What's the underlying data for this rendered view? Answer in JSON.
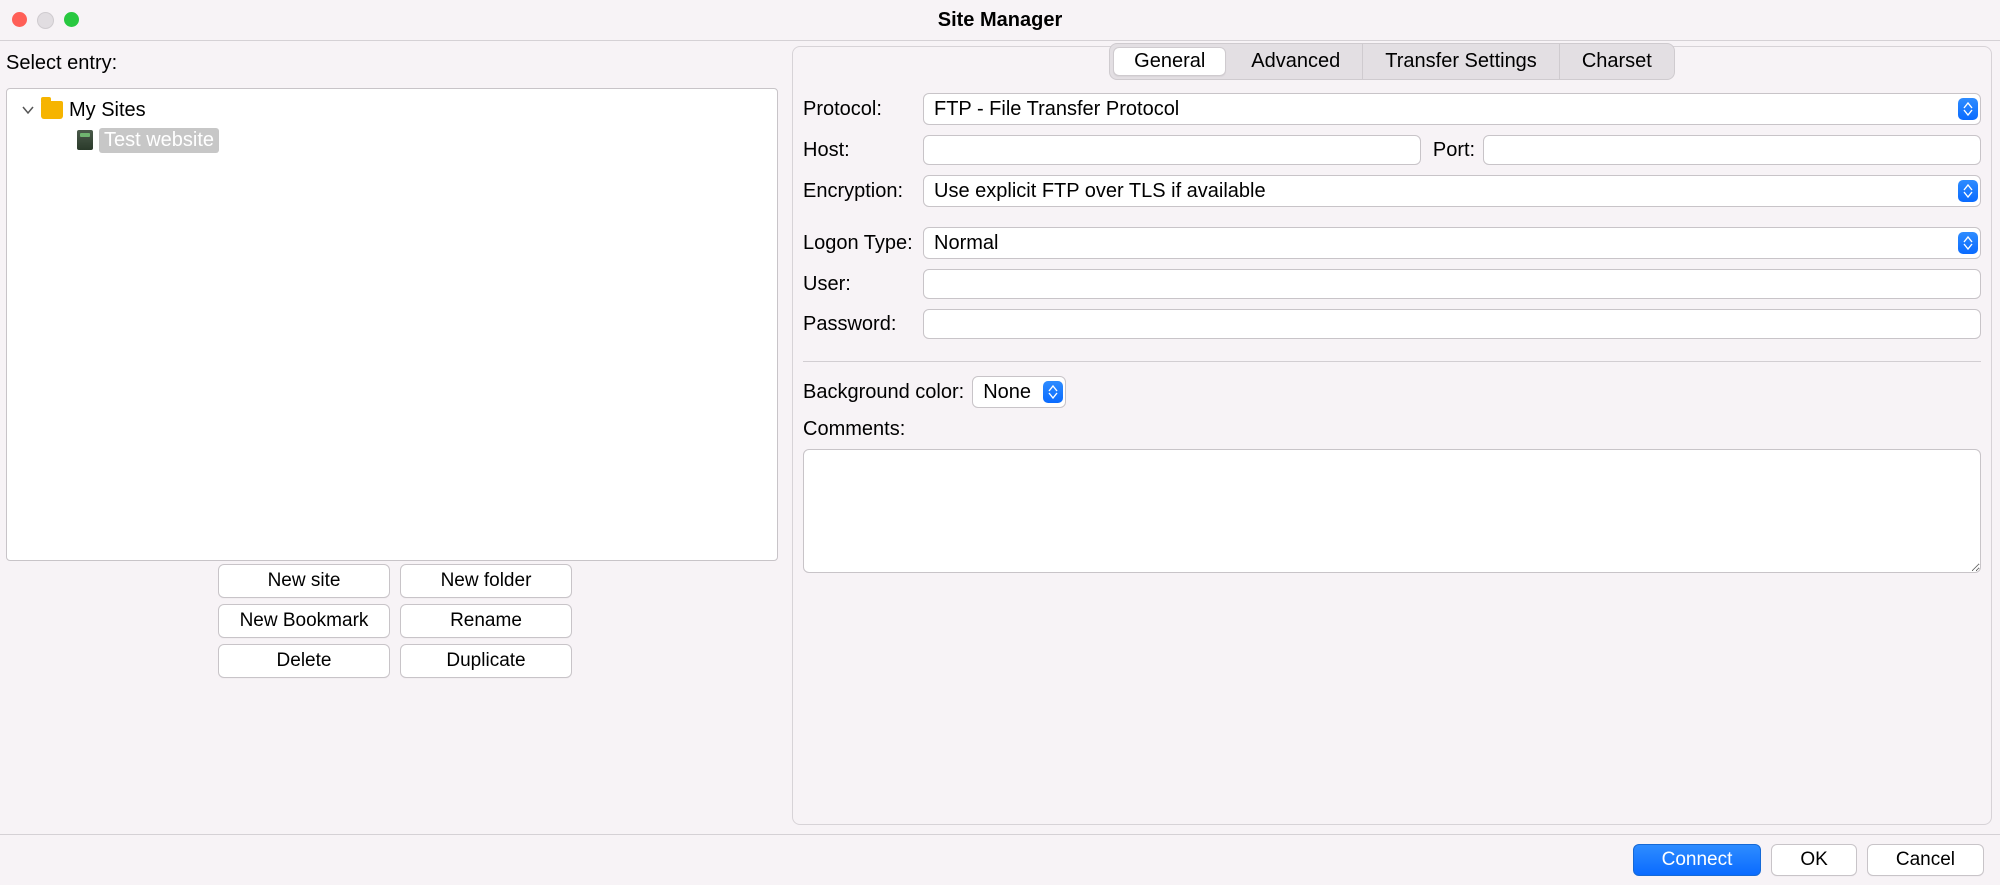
{
  "window": {
    "title": "Site Manager"
  },
  "left": {
    "select_entry_label": "Select entry:",
    "tree": {
      "root_label": "My Sites",
      "site_label": "Test website"
    },
    "buttons": {
      "new_site": "New site",
      "new_folder": "New folder",
      "new_bookmark": "New Bookmark",
      "rename": "Rename",
      "delete": "Delete",
      "duplicate": "Duplicate"
    }
  },
  "tabs": {
    "general": "General",
    "advanced": "Advanced",
    "transfer": "Transfer Settings",
    "charset": "Charset"
  },
  "form": {
    "protocol_label": "Protocol:",
    "protocol_value": "FTP - File Transfer Protocol",
    "host_label": "Host:",
    "host_value": "",
    "port_label": "Port:",
    "port_value": "",
    "encryption_label": "Encryption:",
    "encryption_value": "Use explicit FTP over TLS if available",
    "logon_type_label": "Logon Type:",
    "logon_type_value": "Normal",
    "user_label": "User:",
    "user_value": "",
    "password_label": "Password:",
    "password_value": "",
    "bgcolor_label": "Background color:",
    "bgcolor_value": "None",
    "comments_label": "Comments:",
    "comments_value": ""
  },
  "footer": {
    "connect": "Connect",
    "ok": "OK",
    "cancel": "Cancel"
  }
}
